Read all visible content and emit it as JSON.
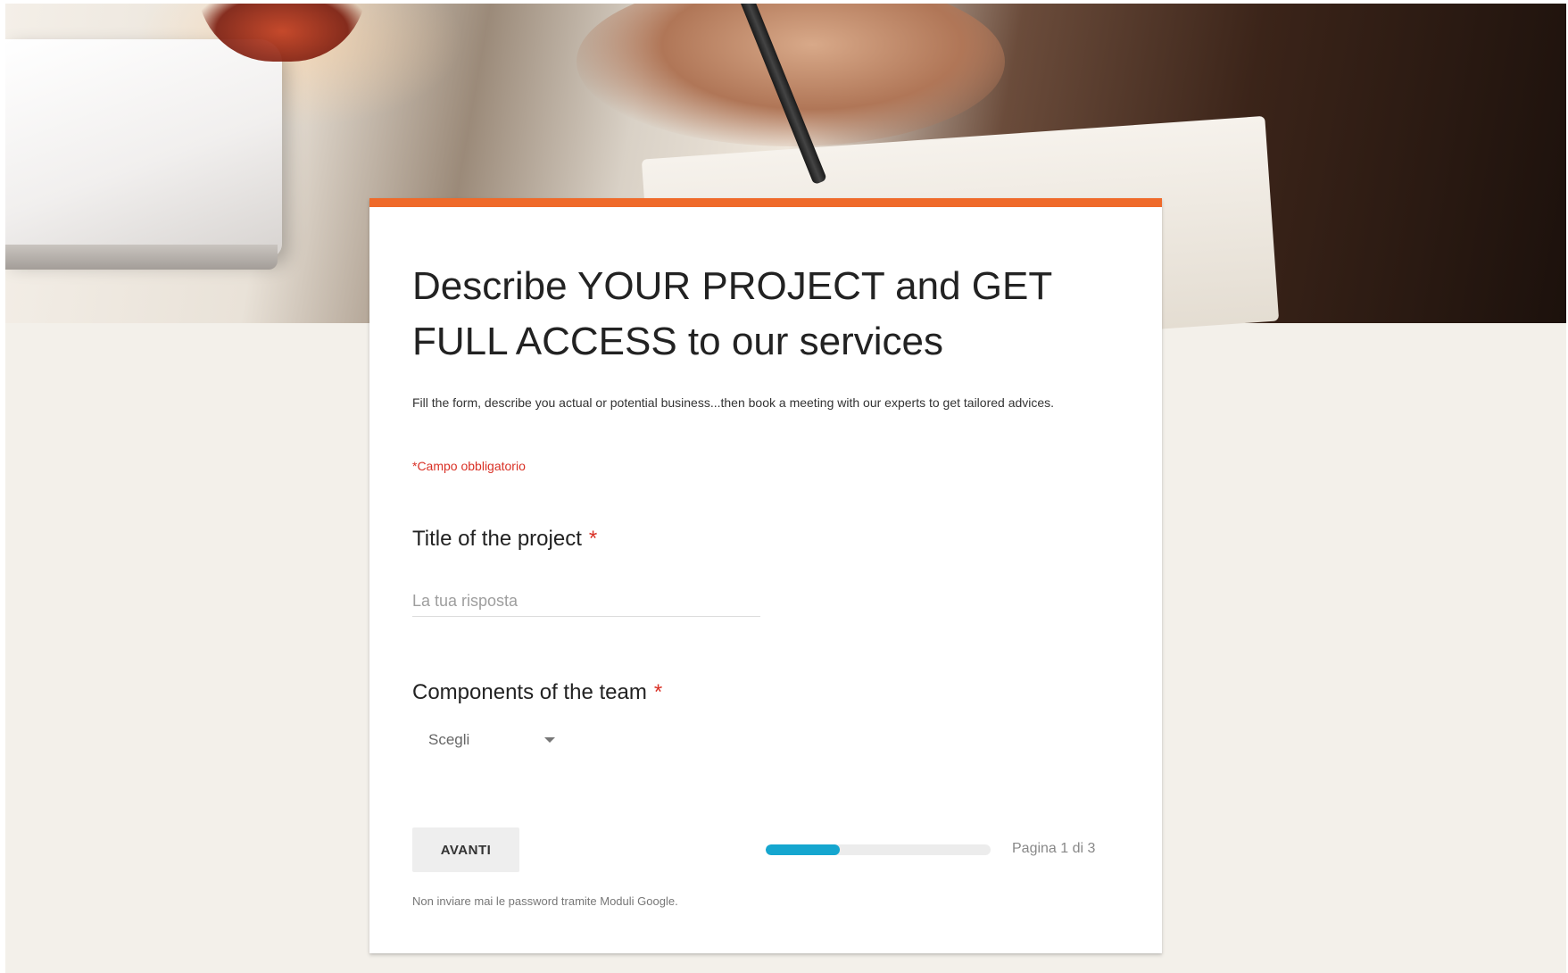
{
  "form": {
    "title": "Describe YOUR PROJECT and GET FULL ACCESS to our services",
    "description": "Fill the form, describe you actual or potential business...then book a meeting with our experts to get tailored advices.",
    "required_note": "*Campo obbligatorio",
    "accent_color": "#ef6a2a",
    "questions": [
      {
        "label": "Title of the project",
        "required_mark": "*",
        "placeholder": "La tua risposta"
      },
      {
        "label": "Components of the team",
        "required_mark": "*",
        "selected_value": "Scegli"
      }
    ],
    "next_button_label": "AVANTI",
    "progress": {
      "fraction": 0.33,
      "color": "#15a6cf",
      "label": "Pagina 1 di 3"
    },
    "footer_note": "Non inviare mai le password tramite Moduli Google."
  },
  "icons": {
    "dropdown": "chevron-down-icon"
  }
}
